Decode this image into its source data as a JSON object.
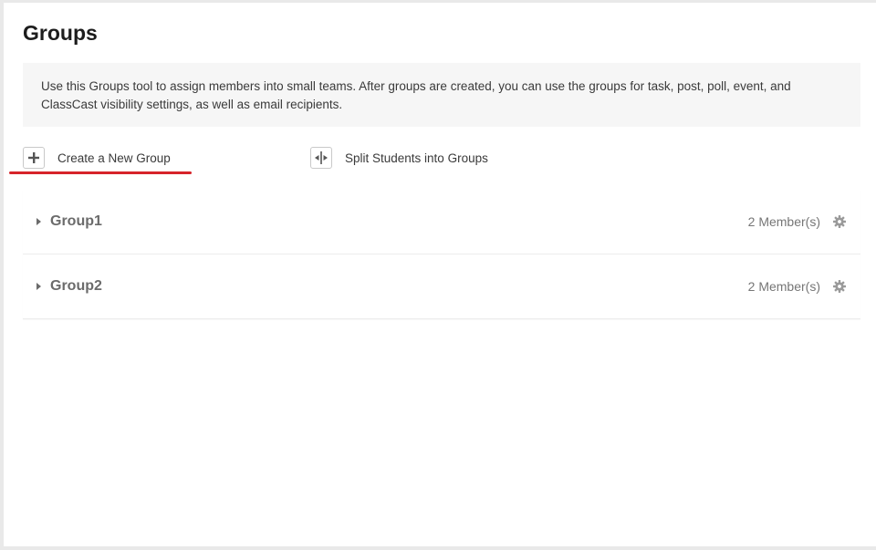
{
  "page": {
    "title": "Groups",
    "info_text": "Use this Groups tool to assign members into small teams. After groups are created, you can use the groups for task, post, poll, event, and ClassCast visibility settings, as well as email recipients."
  },
  "actions": {
    "create_label": "Create a New Group",
    "create_icon": "plus-icon",
    "split_label": "Split Students into Groups",
    "split_icon": "split-icon"
  },
  "groups": [
    {
      "name": "Group1",
      "members": "2 Member(s)"
    },
    {
      "name": "Group2",
      "members": "2 Member(s)"
    }
  ],
  "colors": {
    "highlight_underline": "#d6242a",
    "info_background": "#f6f6f6"
  }
}
